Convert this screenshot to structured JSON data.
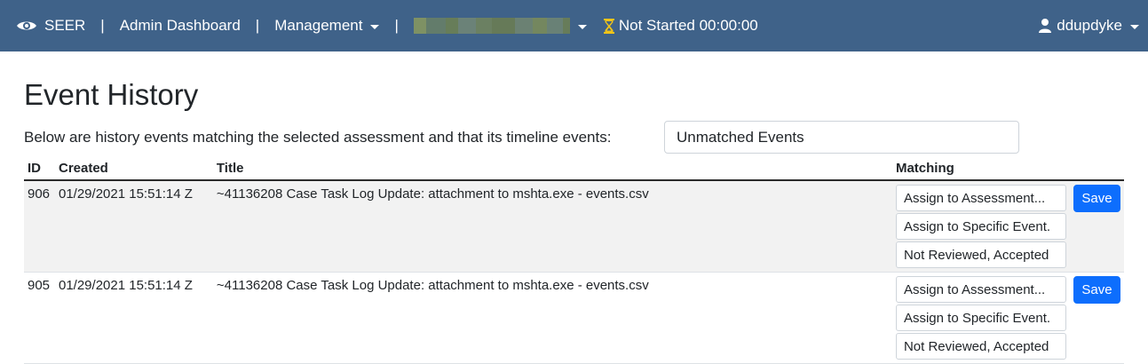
{
  "navbar": {
    "brand": "SEER",
    "separator": "|",
    "admin_dashboard": "Admin Dashboard",
    "management": "Management",
    "timer_status": "Not Started 00:00:00",
    "user": "ddupdyke",
    "colors": {
      "background": "#3f6289",
      "hourglass": "#f0c419"
    }
  },
  "page": {
    "title": "Event History",
    "filter_label": "Below are history events matching the selected assessment and that its timeline events:",
    "filter_value": "Unmatched Events"
  },
  "table": {
    "headers": {
      "id": "ID",
      "created": "Created",
      "title": "Title",
      "matching": "Matching"
    },
    "rows": [
      {
        "id": "906",
        "created": "01/29/2021 15:51:14 Z",
        "title": "~41136208 Case Task Log Update: attachment to mshta.exe - events.csv",
        "options": [
          "Assign to Assessment...",
          "Assign to Specific Event.",
          "Not Reviewed, Accepted"
        ],
        "save_label": "Save"
      },
      {
        "id": "905",
        "created": "01/29/2021 15:51:14 Z",
        "title": "~41136208 Case Task Log Update: attachment to mshta.exe - events.csv",
        "options": [
          "Assign to Assessment...",
          "Assign to Specific Event.",
          "Not Reviewed, Accepted"
        ],
        "save_label": "Save"
      }
    ]
  }
}
